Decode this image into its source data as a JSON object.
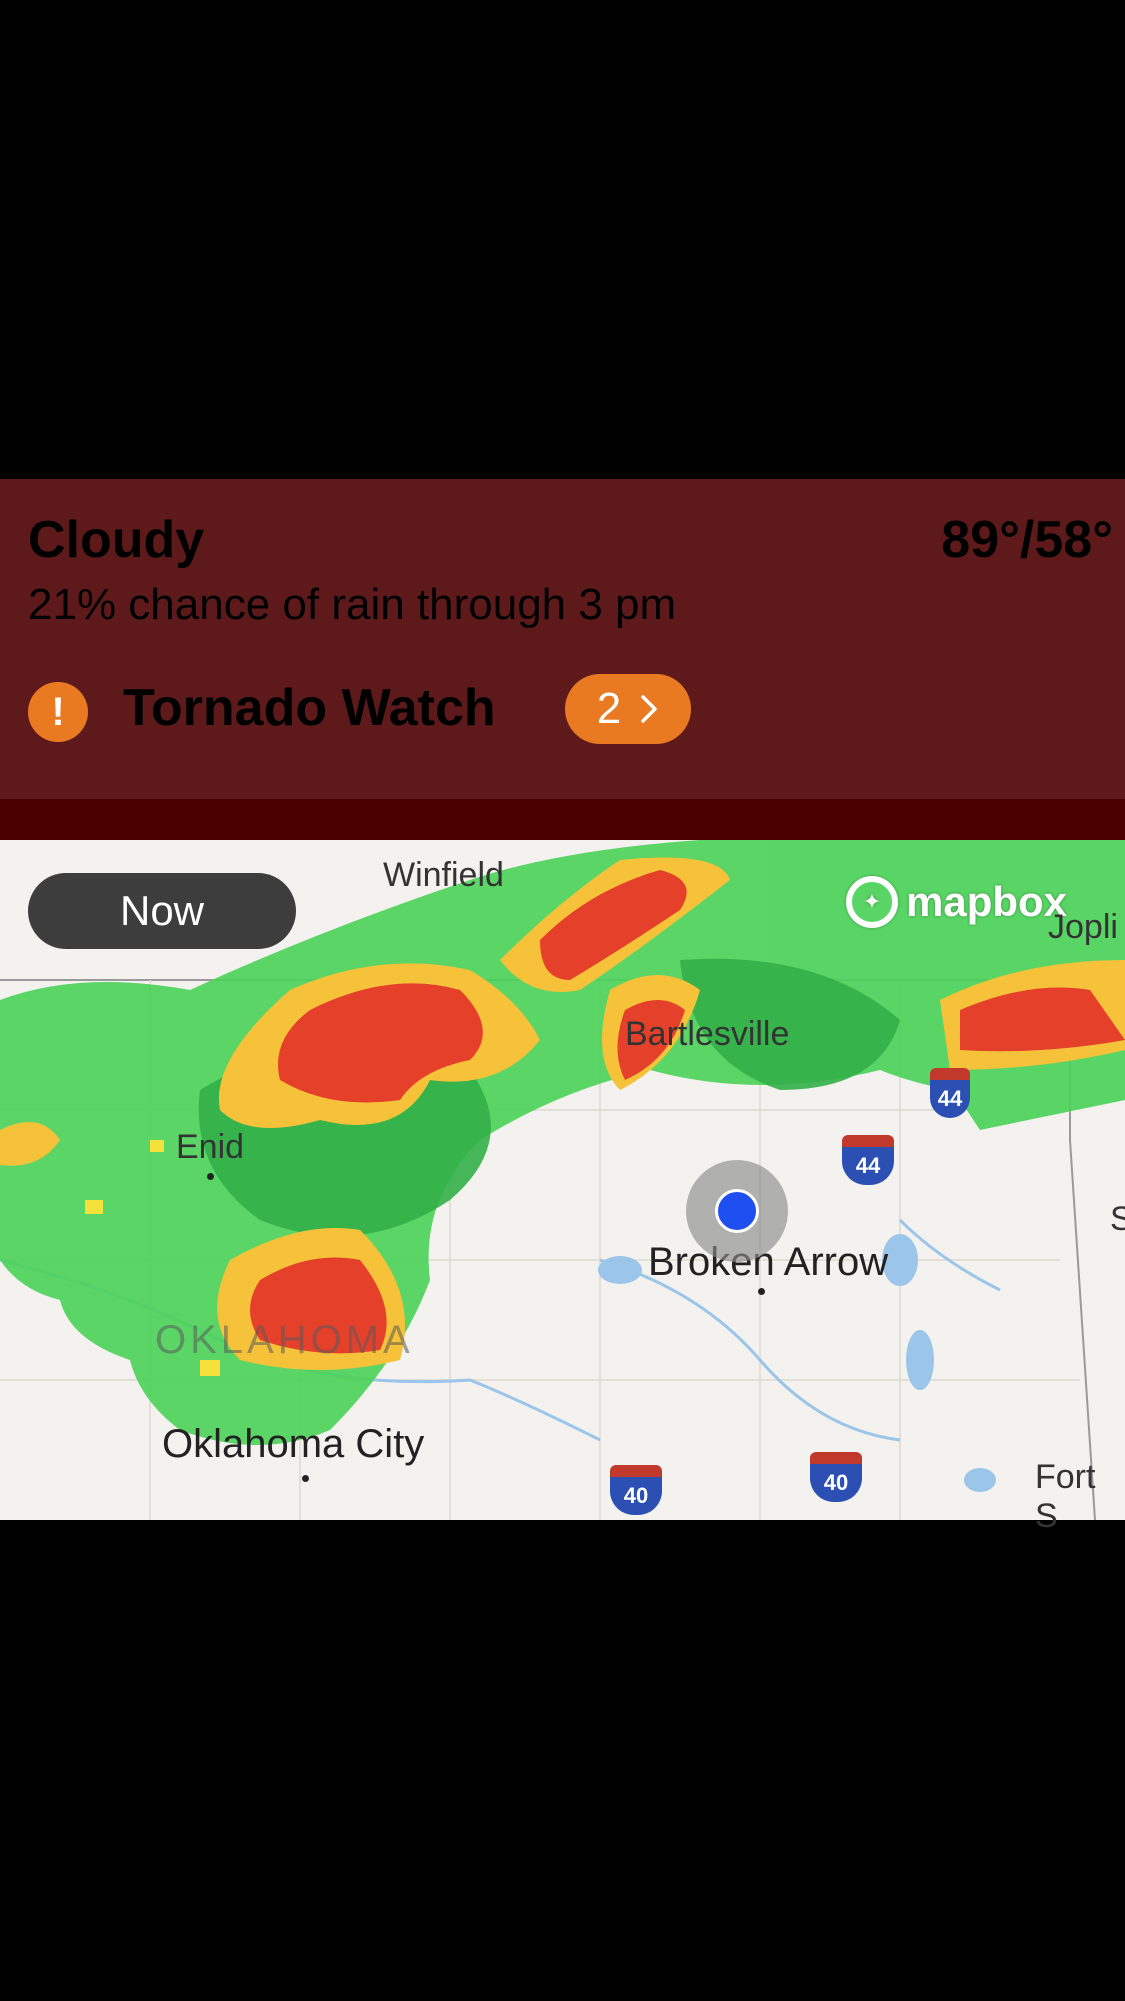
{
  "weather": {
    "condition": "Cloudy",
    "temps": "89°/58°",
    "rain_text": "21% chance of rain through 3 pm"
  },
  "alert": {
    "icon": "exclamation-icon",
    "icon_glyph": "!",
    "title": "Tornado Watch",
    "count": "2",
    "chevron": "chevron-right-icon"
  },
  "map": {
    "time_label": "Now",
    "attribution": "mapbox",
    "cities": {
      "winfield": "Winfield",
      "enid": "Enid",
      "bartlesville": "Bartlesville",
      "broken_arrow": "Broken Arrow",
      "oklahoma_city": "Oklahoma City",
      "oklahoma_state": "OKLAHOMA",
      "joplin": "Jopli",
      "fort_smith": "Fort S",
      "edge_s": "S"
    },
    "highways": {
      "i44_a": "44",
      "i44_b": "44",
      "i40_a": "40",
      "i40_b": "40"
    },
    "colors": {
      "card_bg": "#5e1a1a",
      "accent_orange": "#ea7a22",
      "radar_green": "#4cd35a",
      "radar_yellow": "#f6e03a",
      "radar_red": "#e5402a",
      "location_blue": "#1f4ff0"
    }
  }
}
